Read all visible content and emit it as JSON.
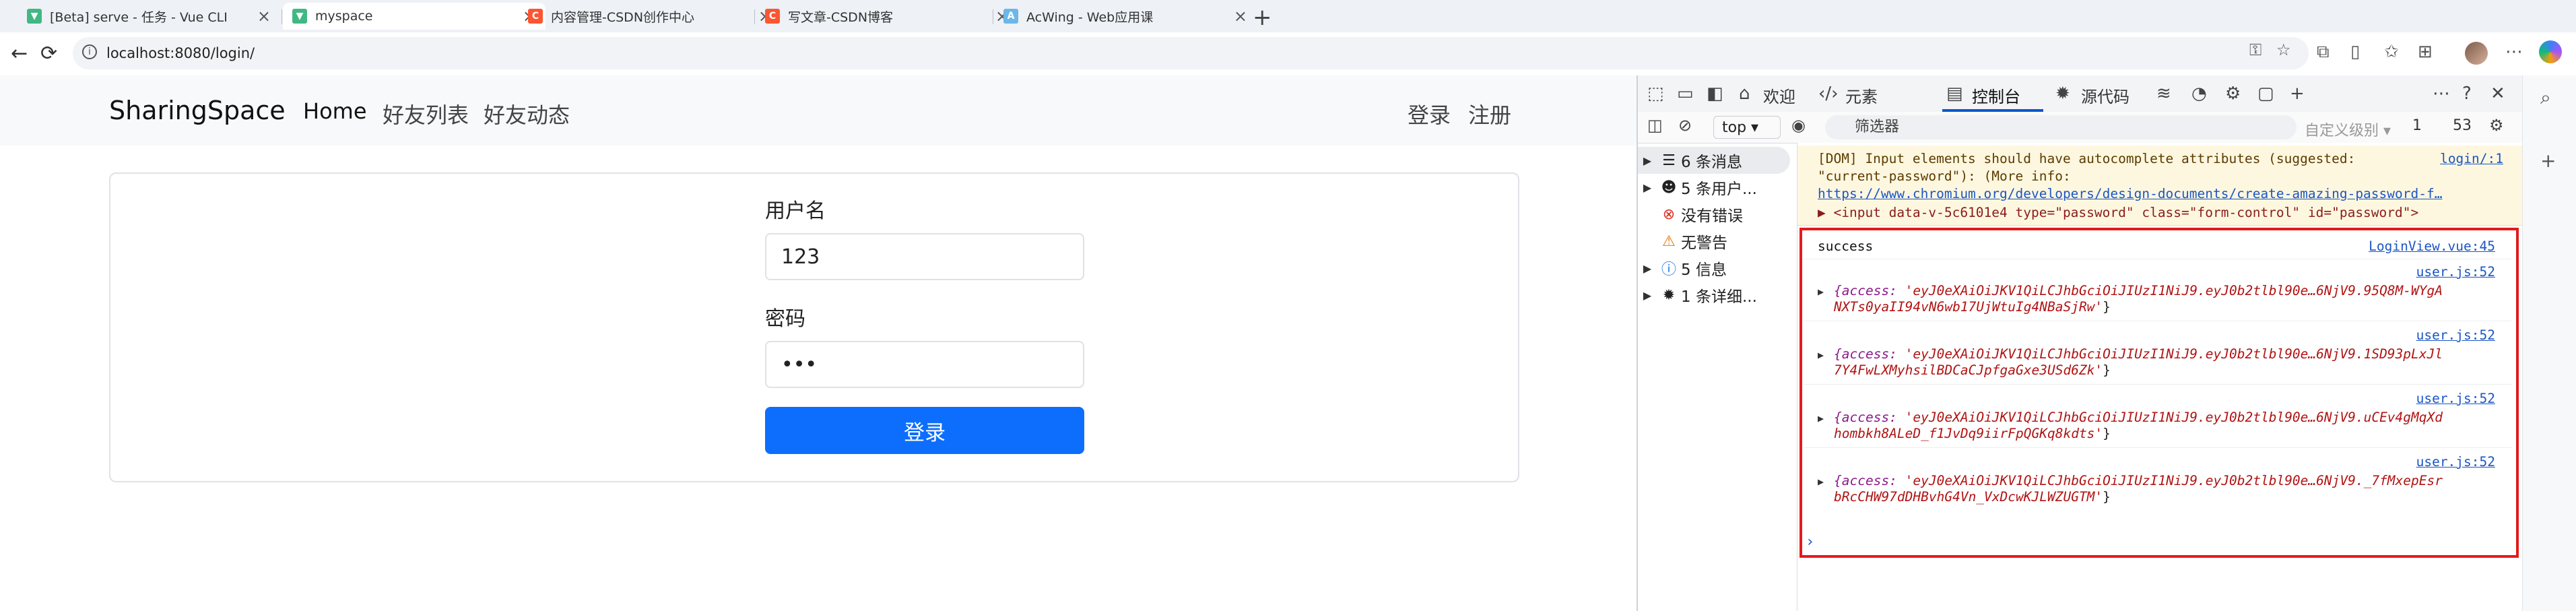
{
  "tabs": [
    {
      "title": "[Beta] serve - 任务 - Vue CLI",
      "icon": "vue-icon",
      "active": false
    },
    {
      "title": "myspace",
      "icon": "vue-icon",
      "active": true
    },
    {
      "title": "内容管理-CSDN创作中心",
      "icon": "csdn-icon",
      "active": false
    },
    {
      "title": "写文章-CSDN博客",
      "icon": "csdn-icon",
      "active": false
    },
    {
      "title": "AcWing - Web应用课",
      "icon": "acwing-icon",
      "active": false
    }
  ],
  "close_glyph": "×",
  "new_tab_glyph": "+",
  "address": {
    "url": "localhost:8080/login/"
  },
  "glyphs": {
    "back": "←",
    "reload": "⟳",
    "info": "i",
    "star": "☆"
  },
  "app": {
    "brand": "SharingSpace",
    "nav": [
      "Home",
      "好友列表",
      "好友动态"
    ],
    "nav_right": [
      "登录",
      "注册"
    ],
    "form": {
      "username_label": "用户名",
      "username_value": "123",
      "password_label": "密码",
      "password_value": "•••",
      "submit": "登录"
    }
  },
  "devtools": {
    "tabs": [
      "欢迎",
      "元素",
      "控制台",
      "源代码"
    ],
    "active_tab": "控制台",
    "context": "top ▾",
    "filter_placeholder": "筛选器",
    "level": "自定义级别 ▾",
    "counts": {
      "issues": "1",
      "messages": "53"
    },
    "sidebar": [
      {
        "label": "6 条消息",
        "icon": "list-icon",
        "caret": "▶",
        "active": true
      },
      {
        "label": "5 条用户...",
        "icon": "user-icon",
        "caret": "▶"
      },
      {
        "label": "没有错误",
        "icon": "error-icon",
        "caret": ""
      },
      {
        "label": "无警告",
        "icon": "warning-icon",
        "caret": ""
      },
      {
        "label": "5 信息",
        "icon": "info-icon",
        "caret": "▶"
      },
      {
        "label": "1 条详细...",
        "icon": "bug-icon",
        "caret": "▶"
      }
    ],
    "warning": {
      "line1": "[DOM] Input elements should have autocomplete attributes (suggested:",
      "line2": "\"current-password\"): (More info:",
      "link": "https://www.chromium.org/developers/design-documents/create-amazing-password-f…",
      "line4": "▶  <input data-v-5c6101e4 type=\"password\" class=\"form-control\" id=\"password\">",
      "source": "login/:1"
    },
    "logs": {
      "success": {
        "text": "success",
        "source": "LoginView.vue:45"
      },
      "objects": [
        {
          "source": "user.js:52",
          "line1_val": "'eyJ0eXAiOiJKV1QiLCJhbGciOiJIUzI1NiJ9.eyJ0b2tlbl90e…6NjV9.95Q8M-WYgA",
          "line2": "NXTs0yaII94vN6wb17UjWtuIg4NBaSjRw'"
        },
        {
          "source": "user.js:52",
          "line1_val": "'eyJ0eXAiOiJKV1QiLCJhbGciOiJIUzI1NiJ9.eyJ0b2tlbl90e…6NjV9.1SD93pLxJl",
          "line2": "7Y4FwLXMyhsilBDCaCJpfgaGxe3USd6Zk'"
        },
        {
          "source": "user.js:52",
          "line1_val": "'eyJ0eXAiOiJKV1QiLCJhbGciOiJIUzI1NiJ9.eyJ0b2tlbl90e…6NjV9.uCEv4gMqXd",
          "line2": "hombkh8ALeD_f1JvDq9iirFpQGKq8kdts'"
        },
        {
          "source": "user.js:52",
          "line1_val": "'eyJ0eXAiOiJKV1QiLCJhbGciOiJIUzI1NiJ9.eyJ0b2tlbl90e…6NjV9._7fMxepEsr",
          "line2": "bRcCHW97dDHBvhG4Vn_VxDcwKJLWZUGTM'"
        }
      ],
      "key_prefix": "{access: ",
      "close_brace": "}"
    },
    "prompt": "›"
  }
}
